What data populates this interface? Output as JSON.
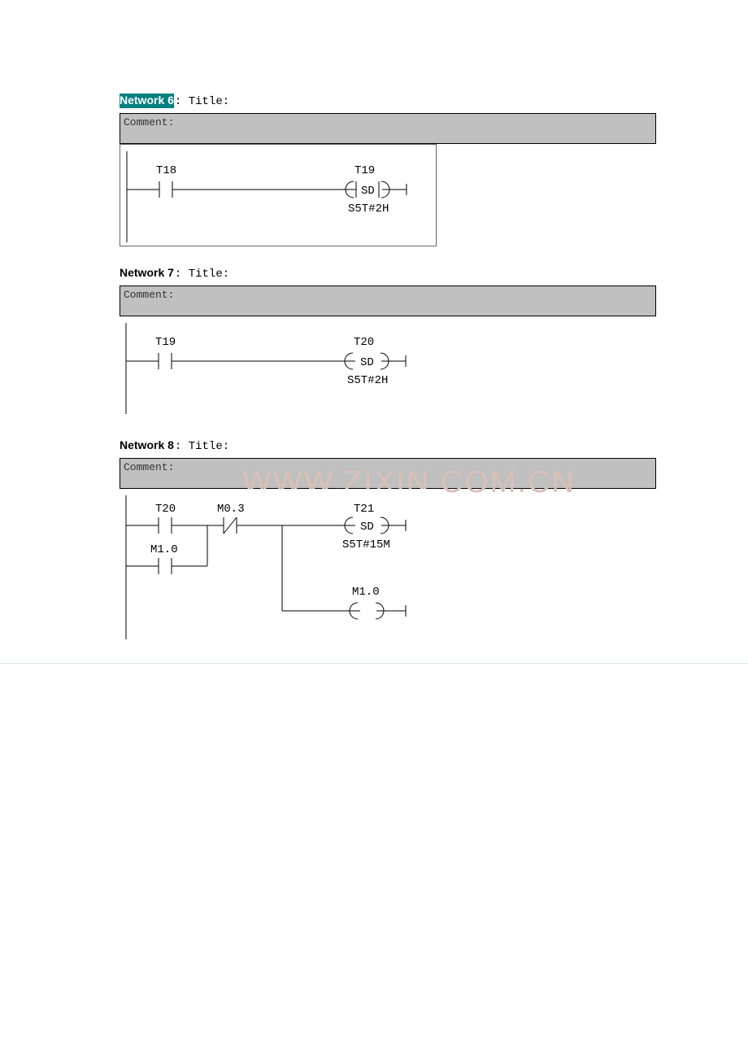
{
  "watermark": "WWW.ZIXIN.COM.CN",
  "networks": [
    {
      "id": "n6",
      "label": "Network 6",
      "selected": true,
      "title_sep": ": Title:",
      "comment_label": "Comment:",
      "rung": {
        "contacts": [
          {
            "addr": "T18",
            "type": "NO"
          }
        ],
        "outputs": [
          {
            "addr": "T19",
            "func": "SD",
            "param": "S5T#2H"
          }
        ]
      }
    },
    {
      "id": "n7",
      "label": "Network 7",
      "selected": false,
      "title_sep": ": Title:",
      "comment_label": "Comment:",
      "rung": {
        "contacts": [
          {
            "addr": "T19",
            "type": "NO"
          }
        ],
        "outputs": [
          {
            "addr": "T20",
            "func": "SD",
            "param": "S5T#2H"
          }
        ]
      }
    },
    {
      "id": "n8",
      "label": "Network 8",
      "selected": false,
      "title_sep": ": Title:",
      "comment_label": "Comment:",
      "rung": {
        "branch_a": [
          {
            "addr": "T20",
            "type": "NO"
          },
          {
            "addr": "M0.3",
            "type": "NC"
          }
        ],
        "branch_b": [
          {
            "addr": "M1.0",
            "type": "NO"
          }
        ],
        "outputs": [
          {
            "addr": "T21",
            "func": "SD",
            "param": "S5T#15M"
          },
          {
            "addr": "M1.0",
            "func": "COIL"
          }
        ]
      }
    }
  ]
}
